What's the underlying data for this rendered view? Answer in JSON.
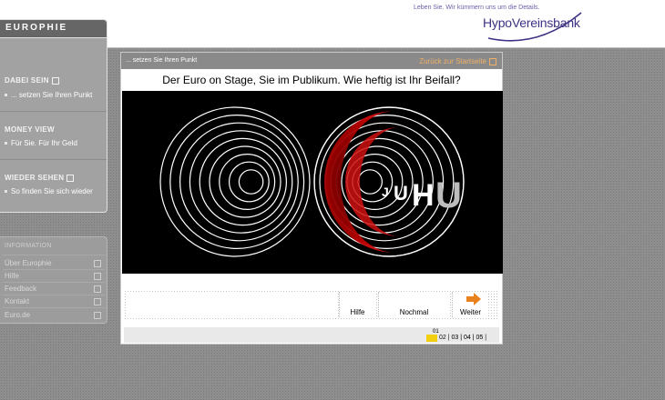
{
  "header": {
    "slogan": "Leben Sie. Wir kümmern uns um die Details.",
    "bank_name": "HypoVereinsbank",
    "brand_color": "#3b3284"
  },
  "sidebar": {
    "logo": "EUROPHIE",
    "sections": [
      {
        "title": "DABEI SEIN",
        "sub": "... setzen Sie Ihren Punkt"
      },
      {
        "title": "MONEY VIEW",
        "sub": "Für Sie. Für Ihr Geld"
      },
      {
        "title": "WIEDER SEHEN",
        "sub": "So finden Sie sich wieder"
      }
    ]
  },
  "info": {
    "title": "INFORMATION",
    "items": [
      "Über Europhie",
      "Hilfe",
      "Feedback",
      "Kontakt",
      "Euro.de"
    ]
  },
  "panel": {
    "breadcrumb": "... setzen Sie Ihren Punkt",
    "back_link": "Zurück zur Startseite",
    "question": "Der Euro on Stage, Sie im Publikum. Wie heftig ist Ihr Beifall?",
    "stage_text": {
      "j": "J",
      "u1": "U",
      "h": "H",
      "u2": "U"
    },
    "buttons": {
      "help": "Hilfe",
      "again": "Nochmal",
      "next": "Weiter"
    },
    "pages": {
      "current": "01",
      "rest": "02 | 03 | 04 | 05 |"
    },
    "accent_color": "#e8821e",
    "highlight_color": "#f2cf10"
  }
}
